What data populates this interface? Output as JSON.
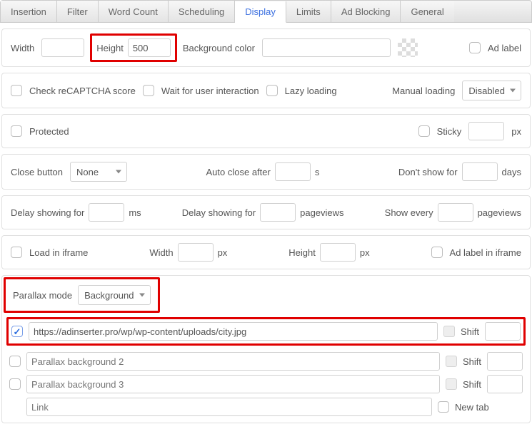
{
  "tabs": [
    "Insertion",
    "Filter",
    "Word Count",
    "Scheduling",
    "Display",
    "Limits",
    "Ad Blocking",
    "General"
  ],
  "active_tab": "Display",
  "dims": {
    "width_label": "Width",
    "width_value": "",
    "height_label": "Height",
    "height_value": "500",
    "bgcolor_label": "Background color",
    "bgcolor_value": "",
    "ad_label": "Ad label"
  },
  "row2": {
    "recaptcha": "Check reCAPTCHA score",
    "wait_interaction": "Wait for user interaction",
    "lazy": "Lazy loading",
    "manual_loading_label": "Manual loading",
    "manual_loading_value": "Disabled"
  },
  "row3": {
    "protected": "Protected",
    "sticky": "Sticky",
    "sticky_value": "",
    "sticky_unit": "px"
  },
  "row4": {
    "close_button_label": "Close button",
    "close_button_value": "None",
    "auto_close_label": "Auto close after",
    "auto_close_value": "",
    "auto_close_unit": "s",
    "dont_show_label": "Don't show for",
    "dont_show_value": "",
    "dont_show_unit": "days"
  },
  "row5": {
    "delay_ms_label": "Delay showing for",
    "delay_ms_value": "",
    "delay_ms_unit": "ms",
    "delay_pv_label": "Delay showing for",
    "delay_pv_value": "",
    "delay_pv_unit": "pageviews",
    "show_every_label": "Show every",
    "show_every_value": "",
    "show_every_unit": "pageviews"
  },
  "row6": {
    "load_iframe": "Load in iframe",
    "width_label": "Width",
    "width_value": "",
    "width_unit": "px",
    "height_label": "Height",
    "height_value": "",
    "height_unit": "px",
    "ad_label_iframe": "Ad label in iframe"
  },
  "parallax": {
    "mode_label": "Parallax mode",
    "mode_value": "Background",
    "shift_label": "Shift",
    "newtab_label": "New tab",
    "link_placeholder": "Link",
    "rows": [
      {
        "checked": true,
        "value": "https://adinserter.pro/wp/wp-content/uploads/city.jpg",
        "placeholder": "",
        "shift": ""
      },
      {
        "checked": false,
        "value": "",
        "placeholder": "Parallax background 2",
        "shift": ""
      },
      {
        "checked": false,
        "value": "",
        "placeholder": "Parallax background 3",
        "shift": ""
      }
    ]
  }
}
